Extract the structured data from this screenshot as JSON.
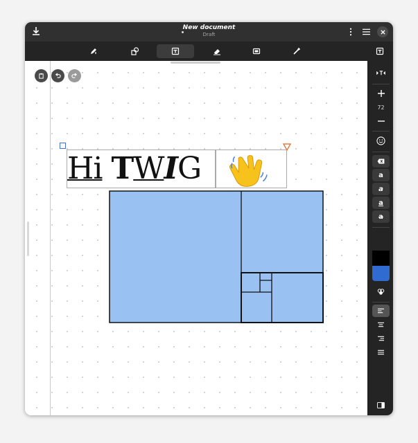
{
  "window": {
    "title": "New document",
    "subtitle": "Draft"
  },
  "toolbar": {
    "tools": [
      {
        "name": "pen-tool",
        "icon": "pen-icon"
      },
      {
        "name": "shapes-tool",
        "icon": "shapes-icon"
      },
      {
        "name": "text-tool",
        "icon": "text-icon",
        "active": true
      },
      {
        "name": "eraser-tool",
        "icon": "eraser-icon"
      },
      {
        "name": "selector-tool",
        "icon": "selector-icon"
      },
      {
        "name": "tools-tool",
        "icon": "wrench-icon"
      }
    ]
  },
  "canvas": {
    "text_line": {
      "hi": "Hi",
      "t": "T",
      "w": "W",
      "i": "I",
      "g": "G"
    },
    "emoji": "👋"
  },
  "sidebar": {
    "font_size": "72",
    "style_labels": {
      "regular": "a",
      "italic": "a",
      "underline": "a",
      "strike": "a"
    },
    "color_primary": "#000000",
    "color_secondary": "#2f6bd1"
  },
  "colors": {
    "golden_fill": "#99c1f1",
    "text_box_border": "#aaaaaa",
    "selection_square": "#3a6fd8",
    "selection_triangle": "#e8601c"
  }
}
